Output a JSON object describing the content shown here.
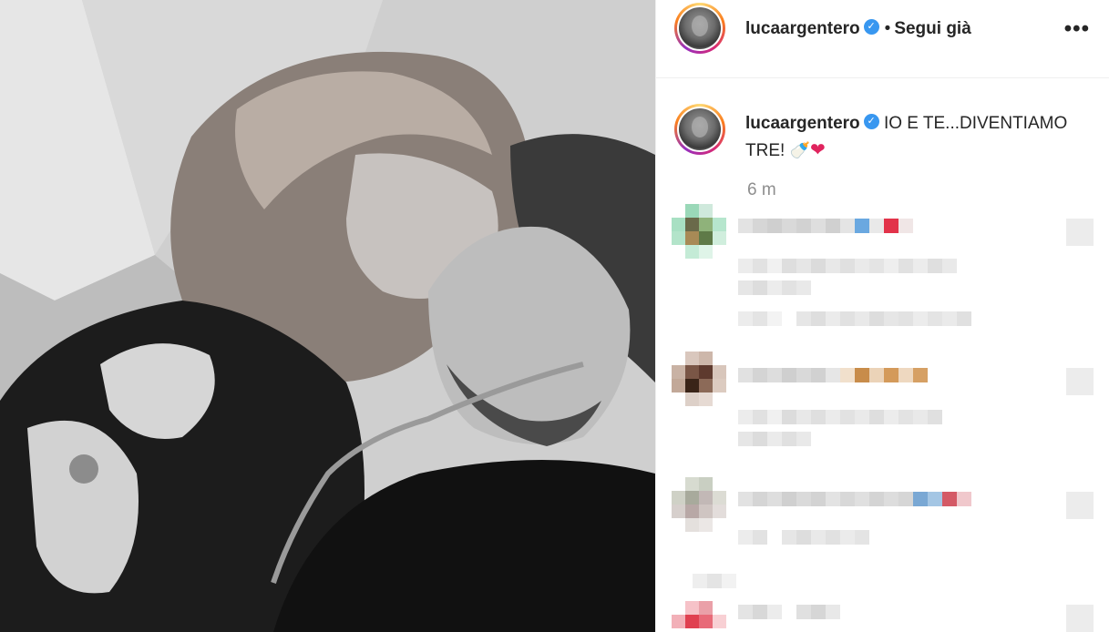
{
  "post": {
    "image_alt": "Black and white photo of a couple on a sofa; the man listens through a stethoscope.",
    "header": {
      "username": "lucaargentero",
      "verified_icon": "verified-badge-icon",
      "separator": "•",
      "follow_label": "Segui già",
      "more_icon": "more-options-icon",
      "more_label": "•••"
    },
    "caption": {
      "username": "lucaargentero",
      "text": "IO E TE...DIVENTIAMO TRE!",
      "emojis": [
        "🍼",
        "❤"
      ],
      "time": "6 m"
    },
    "comments": [
      {
        "id": 1,
        "censored": true
      },
      {
        "id": 2,
        "censored": true
      },
      {
        "id": 3,
        "censored": true
      },
      {
        "id": 4,
        "censored": true
      }
    ],
    "colors": {
      "accent_verified": "#3897f0",
      "text": "#262626",
      "muted": "#8e8e8e",
      "heart": "#e0245e"
    }
  }
}
